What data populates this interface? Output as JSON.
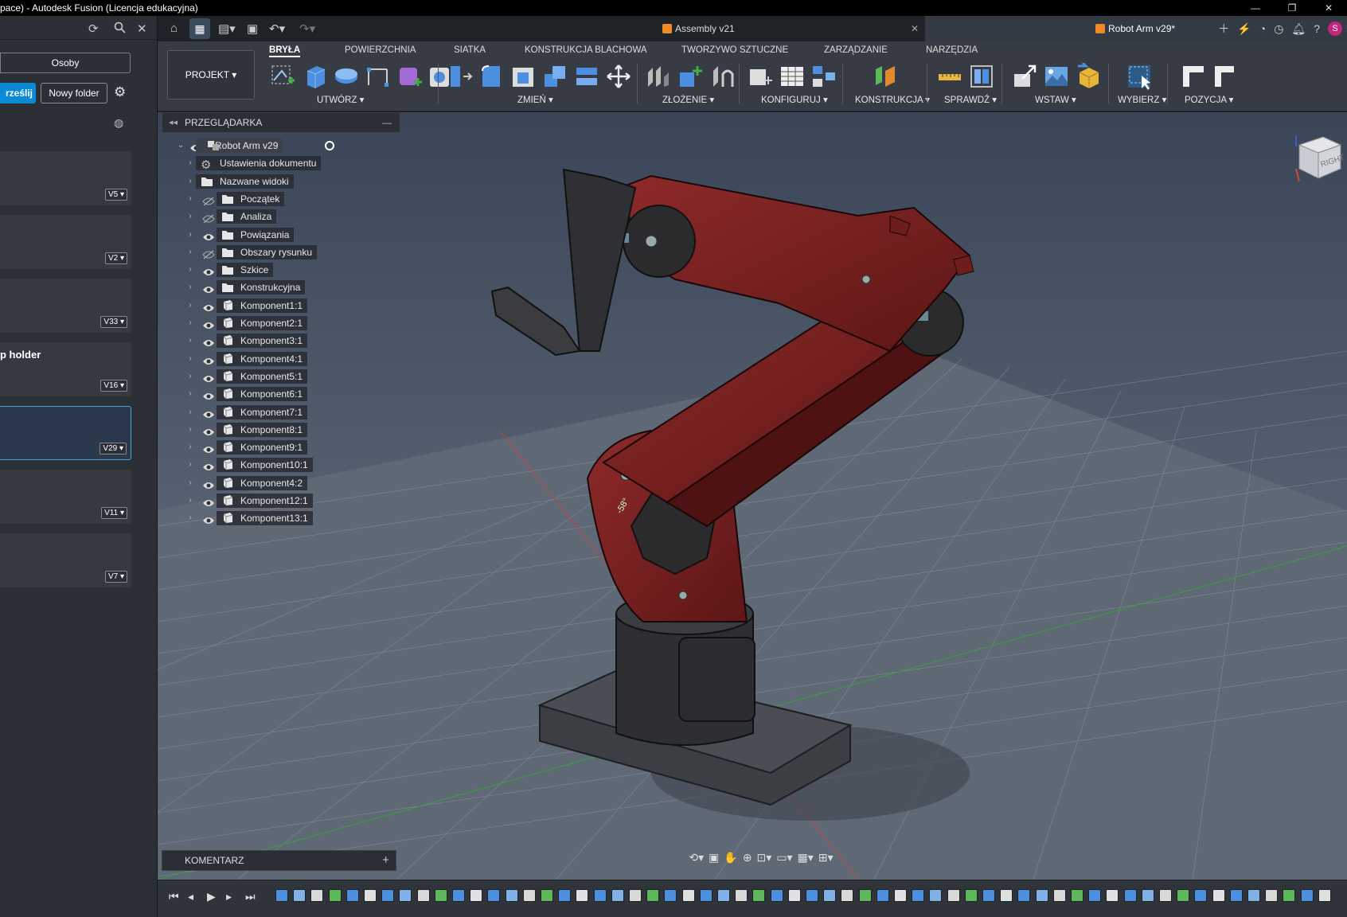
{
  "titlebar": {
    "title": "pace) - Autodesk Fusion (Licencja edukacyjna)",
    "minimize": "—",
    "restore": "❐",
    "close": "✕"
  },
  "data_panel": {
    "people_button": "Osoby",
    "upload_button": "rześlij",
    "new_folder_button": "Nowy folder",
    "cards": [
      {
        "name": "",
        "version": "V5 ▾"
      },
      {
        "name": "",
        "version": "V2 ▾"
      },
      {
        "name": "",
        "version": "V33 ▾"
      },
      {
        "name": "p holder",
        "version": "V16 ▾"
      },
      {
        "name": "",
        "version": "V29 ▾",
        "selected": true
      },
      {
        "name": "",
        "version": "V11 ▾"
      },
      {
        "name": "",
        "version": "V7 ▾"
      }
    ]
  },
  "tabs": [
    {
      "label": "Assembly v21",
      "active": false
    },
    {
      "label": "Robot Arm v29*",
      "active": true
    }
  ],
  "user_initial": "S",
  "toolbar": {
    "workspace_button": "PROJEKT ▾",
    "workspace_tabs": [
      "BRYŁA",
      "POWIERZCHNIA",
      "SIATKA",
      "KONSTRUKCJA BLACHOWA",
      "TWORZYWO SZTUCZNE",
      "ZARZĄDZANIE",
      "NARZĘDZIA"
    ],
    "groups": [
      "UTWÓRZ ▾",
      "ZMIEŃ ▾",
      "ZŁOŻENIE ▾",
      "KONFIGURUJ ▾",
      "KONSTRUKCJA ▾",
      "SPRAWDŹ ▾",
      "WSTAW ▾",
      "WYBIERZ ▾",
      "POZYCJA ▾"
    ]
  },
  "browser": {
    "header": "PRZEGLĄDARKA",
    "root": "Robot Arm v29",
    "items": [
      {
        "label": "Ustawienia dokumentu",
        "icon": "gear-icon",
        "eye": "none"
      },
      {
        "label": "Nazwane widoki",
        "icon": "folder-icon",
        "eye": "none"
      },
      {
        "label": "Początek",
        "icon": "folder-icon",
        "eye": "hidden"
      },
      {
        "label": "Analiza",
        "icon": "folder-icon",
        "eye": "hidden"
      },
      {
        "label": "Powiązania",
        "icon": "folder-icon",
        "eye": "visible"
      },
      {
        "label": "Obszary rysunku",
        "icon": "folder-icon",
        "eye": "hidden"
      },
      {
        "label": "Szkice",
        "icon": "folder-icon",
        "eye": "visible"
      },
      {
        "label": "Konstrukcyjna",
        "icon": "folder-icon",
        "eye": "visible"
      },
      {
        "label": "Komponent1:1",
        "icon": "component-icon",
        "eye": "visible"
      },
      {
        "label": "Komponent2:1",
        "icon": "component-icon",
        "eye": "visible"
      },
      {
        "label": "Komponent3:1",
        "icon": "component-icon",
        "eye": "visible"
      },
      {
        "label": "Komponent4:1",
        "icon": "component-icon",
        "eye": "visible"
      },
      {
        "label": "Komponent5:1",
        "icon": "component-icon",
        "eye": "visible"
      },
      {
        "label": "Komponent6:1",
        "icon": "component-icon",
        "eye": "visible"
      },
      {
        "label": "Komponent7:1",
        "icon": "component-icon",
        "eye": "visible"
      },
      {
        "label": "Komponent8:1",
        "icon": "component-icon",
        "eye": "visible"
      },
      {
        "label": "Komponent9:1",
        "icon": "component-icon",
        "eye": "visible"
      },
      {
        "label": "Komponent10:1",
        "icon": "component-icon",
        "eye": "visible"
      },
      {
        "label": "Komponent4:2",
        "icon": "component-icon",
        "eye": "visible"
      },
      {
        "label": "Komponent12:1",
        "icon": "component-icon",
        "eye": "visible"
      },
      {
        "label": "Komponent13:1",
        "icon": "component-icon",
        "eye": "visible"
      }
    ]
  },
  "comments": {
    "header": "KOMENTARZ",
    "add": "+"
  },
  "viewcube": {
    "face": "RIGHT"
  },
  "viewport": {
    "angle_label": "-58°"
  },
  "colors": {
    "accent": "#0c8ad6",
    "arm_red": "#7a1e1e",
    "arm_dark": "#2f2f31",
    "background_top": "#3a4658",
    "background_bottom": "#6f7886"
  }
}
